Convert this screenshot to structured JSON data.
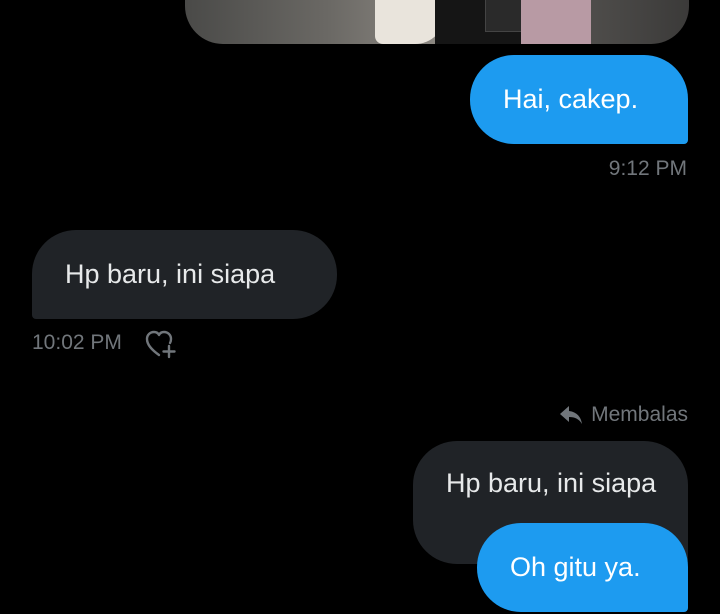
{
  "conversation": {
    "media": {
      "icon": "image-thumbnail"
    },
    "messages": [
      {
        "text": "Hai, cakep.",
        "time": "9:12 PM",
        "direction": "sent"
      },
      {
        "text": "Hp baru, ini siapa",
        "time": "10:02 PM",
        "direction": "received"
      },
      {
        "text": "Oh gitu ya.",
        "direction": "sent"
      }
    ],
    "reply": {
      "label": "Membalas",
      "quoted_text": "Hp baru, ini siapa",
      "icon": "reply-arrow-icon"
    },
    "reaction_icon": "heart-plus-icon"
  },
  "colors": {
    "background": "#000000",
    "sent_bubble": "#1d9bf0",
    "received_bubble": "#202327",
    "muted_text": "#71767b"
  }
}
